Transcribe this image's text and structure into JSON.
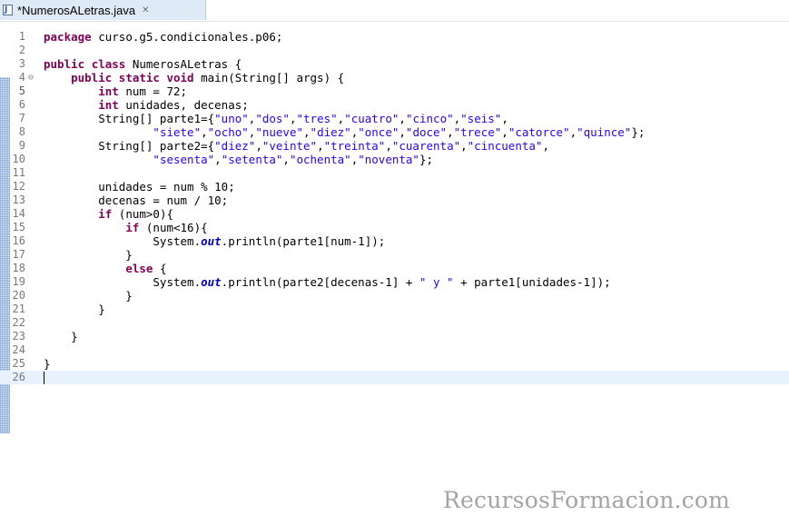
{
  "tab": {
    "icon_letter": "J",
    "title": "*NumerosALetras.java",
    "close_glyph": "✕"
  },
  "fold_marker": "⊖",
  "current_line": 5,
  "lines": [
    {
      "n": "1",
      "segs": [
        {
          "t": "kw",
          "v": "package"
        },
        {
          "t": "p",
          "v": " curso.g5.condicionales.p06;"
        }
      ]
    },
    {
      "n": "2",
      "segs": []
    },
    {
      "n": "3",
      "segs": [
        {
          "t": "kw",
          "v": "public"
        },
        {
          "t": "p",
          "v": " "
        },
        {
          "t": "kw",
          "v": "class"
        },
        {
          "t": "p",
          "v": " NumerosALetras {"
        }
      ]
    },
    {
      "n": "4",
      "fold": true,
      "segs": [
        {
          "t": "p",
          "v": "    "
        },
        {
          "t": "kw",
          "v": "public"
        },
        {
          "t": "p",
          "v": " "
        },
        {
          "t": "kw",
          "v": "static"
        },
        {
          "t": "p",
          "v": " "
        },
        {
          "t": "kw",
          "v": "void"
        },
        {
          "t": "p",
          "v": " main(String[] args) {"
        }
      ]
    },
    {
      "n": "5",
      "segs": [
        {
          "t": "p",
          "v": "        "
        },
        {
          "t": "kw",
          "v": "int"
        },
        {
          "t": "p",
          "v": " num = 72;"
        }
      ]
    },
    {
      "n": "6",
      "segs": [
        {
          "t": "p",
          "v": "        "
        },
        {
          "t": "kw",
          "v": "int"
        },
        {
          "t": "p",
          "v": " unidades, decenas;"
        }
      ]
    },
    {
      "n": "7",
      "segs": [
        {
          "t": "p",
          "v": "        String[] parte1={"
        },
        {
          "t": "str",
          "v": "\"uno\""
        },
        {
          "t": "p",
          "v": ","
        },
        {
          "t": "str",
          "v": "\"dos\""
        },
        {
          "t": "p",
          "v": ","
        },
        {
          "t": "str",
          "v": "\"tres\""
        },
        {
          "t": "p",
          "v": ","
        },
        {
          "t": "str",
          "v": "\"cuatro\""
        },
        {
          "t": "p",
          "v": ","
        },
        {
          "t": "str",
          "v": "\"cinco\""
        },
        {
          "t": "p",
          "v": ","
        },
        {
          "t": "str",
          "v": "\"seis\""
        },
        {
          "t": "p",
          "v": ","
        }
      ]
    },
    {
      "n": "8",
      "segs": [
        {
          "t": "p",
          "v": "                "
        },
        {
          "t": "str",
          "v": "\"siete\""
        },
        {
          "t": "p",
          "v": ","
        },
        {
          "t": "str",
          "v": "\"ocho\""
        },
        {
          "t": "p",
          "v": ","
        },
        {
          "t": "str",
          "v": "\"nueve\""
        },
        {
          "t": "p",
          "v": ","
        },
        {
          "t": "str",
          "v": "\"diez\""
        },
        {
          "t": "p",
          "v": ","
        },
        {
          "t": "str",
          "v": "\"once\""
        },
        {
          "t": "p",
          "v": ","
        },
        {
          "t": "str",
          "v": "\"doce\""
        },
        {
          "t": "p",
          "v": ","
        },
        {
          "t": "str",
          "v": "\"trece\""
        },
        {
          "t": "p",
          "v": ","
        },
        {
          "t": "str",
          "v": "\"catorce\""
        },
        {
          "t": "p",
          "v": ","
        },
        {
          "t": "str",
          "v": "\"quince\""
        },
        {
          "t": "p",
          "v": "};"
        }
      ]
    },
    {
      "n": "9",
      "segs": [
        {
          "t": "p",
          "v": "        String[] parte2={"
        },
        {
          "t": "str",
          "v": "\"diez\""
        },
        {
          "t": "p",
          "v": ","
        },
        {
          "t": "str",
          "v": "\"veinte\""
        },
        {
          "t": "p",
          "v": ","
        },
        {
          "t": "str",
          "v": "\"treinta\""
        },
        {
          "t": "p",
          "v": ","
        },
        {
          "t": "str",
          "v": "\"cuarenta\""
        },
        {
          "t": "p",
          "v": ","
        },
        {
          "t": "str",
          "v": "\"cincuenta\""
        },
        {
          "t": "p",
          "v": ","
        }
      ]
    },
    {
      "n": "10",
      "segs": [
        {
          "t": "p",
          "v": "                "
        },
        {
          "t": "str",
          "v": "\"sesenta\""
        },
        {
          "t": "p",
          "v": ","
        },
        {
          "t": "str",
          "v": "\"setenta\""
        },
        {
          "t": "p",
          "v": ","
        },
        {
          "t": "str",
          "v": "\"ochenta\""
        },
        {
          "t": "p",
          "v": ","
        },
        {
          "t": "str",
          "v": "\"noventa\""
        },
        {
          "t": "p",
          "v": "};"
        }
      ]
    },
    {
      "n": "11",
      "segs": []
    },
    {
      "n": "12",
      "segs": [
        {
          "t": "p",
          "v": "        unidades = num % 10;"
        }
      ]
    },
    {
      "n": "13",
      "segs": [
        {
          "t": "p",
          "v": "        decenas = num / 10;"
        }
      ]
    },
    {
      "n": "14",
      "segs": [
        {
          "t": "p",
          "v": "        "
        },
        {
          "t": "kw",
          "v": "if"
        },
        {
          "t": "p",
          "v": " (num>0){"
        }
      ]
    },
    {
      "n": "15",
      "segs": [
        {
          "t": "p",
          "v": "            "
        },
        {
          "t": "kw",
          "v": "if"
        },
        {
          "t": "p",
          "v": " (num<16){"
        }
      ]
    },
    {
      "n": "16",
      "segs": [
        {
          "t": "p",
          "v": "                System."
        },
        {
          "t": "fld",
          "v": "out"
        },
        {
          "t": "p",
          "v": ".println(parte1[num-1]);"
        }
      ]
    },
    {
      "n": "17",
      "segs": [
        {
          "t": "p",
          "v": "            }"
        }
      ]
    },
    {
      "n": "18",
      "segs": [
        {
          "t": "p",
          "v": "            "
        },
        {
          "t": "kw",
          "v": "else"
        },
        {
          "t": "p",
          "v": " {"
        }
      ]
    },
    {
      "n": "19",
      "segs": [
        {
          "t": "p",
          "v": "                System."
        },
        {
          "t": "fld",
          "v": "out"
        },
        {
          "t": "p",
          "v": ".println(parte2[decenas-1] + "
        },
        {
          "t": "str",
          "v": "\" y \""
        },
        {
          "t": "p",
          "v": " + parte1[unidades-1]);"
        }
      ]
    },
    {
      "n": "20",
      "segs": [
        {
          "t": "p",
          "v": "            }"
        }
      ]
    },
    {
      "n": "21",
      "segs": [
        {
          "t": "p",
          "v": "        }"
        }
      ]
    },
    {
      "n": "22",
      "segs": []
    },
    {
      "n": "23",
      "segs": [
        {
          "t": "p",
          "v": "    }"
        }
      ]
    },
    {
      "n": "24",
      "segs": []
    },
    {
      "n": "25",
      "segs": [
        {
          "t": "p",
          "v": "}"
        }
      ]
    },
    {
      "n": "26",
      "segs": [],
      "caret": true
    }
  ],
  "watermark": "RecursosFormacion.com",
  "colors": {
    "keyword": "#7f0055",
    "string": "#2a00ff",
    "static_field": "#0000c0",
    "current_line_bg": "#e8f2fe",
    "line_number": "#787878"
  }
}
